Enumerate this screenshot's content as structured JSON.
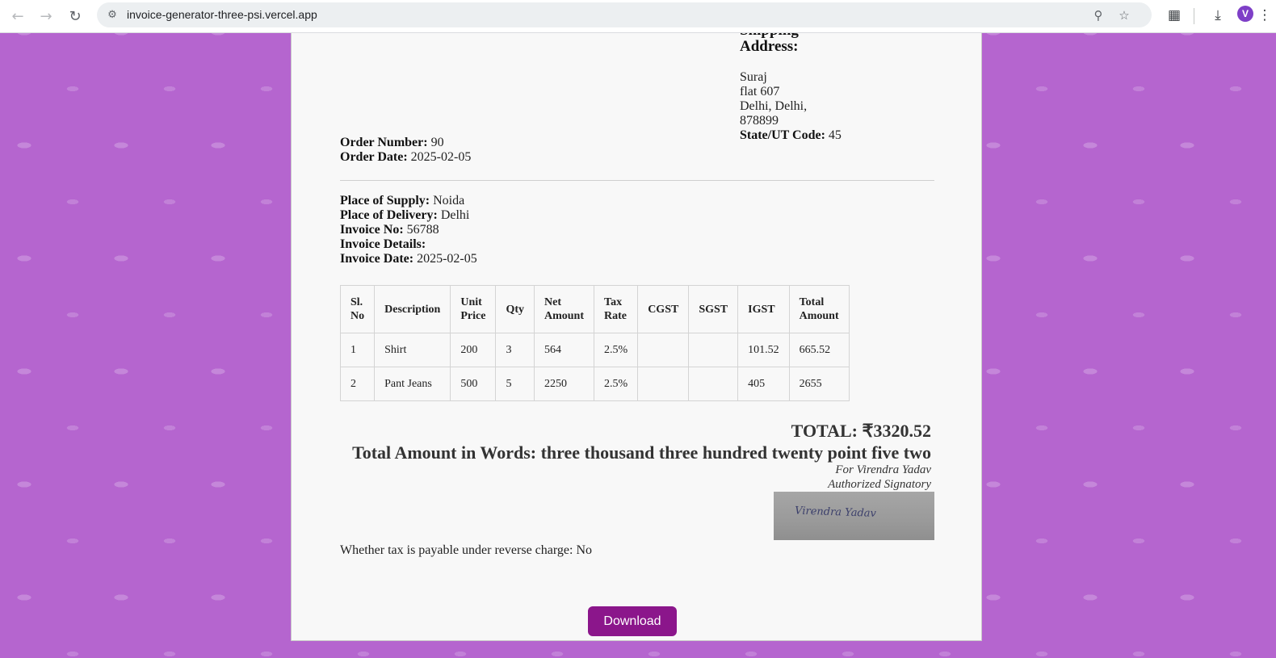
{
  "browser": {
    "url": "invoice-generator-three-psi.vercel.app",
    "avatar_letter": "V",
    "icons": [
      "back-icon",
      "forward-icon",
      "reload-icon",
      "site-settings-icon",
      "location-icon",
      "bookmark-star-icon",
      "extensions-icon",
      "download-icon",
      "more-icon"
    ]
  },
  "shipping": {
    "heading_partial": "Shipping",
    "heading": "Address:",
    "name": "Suraj",
    "line1": "flat 607",
    "line2": "Delhi, Delhi,",
    "pincode": "878899",
    "state_code_label": "State/UT Code:",
    "state_code_value": " 45"
  },
  "order": {
    "number_label": "Order Number:",
    "number_value": " 90",
    "date_label": "Order Date:",
    "date_value": " 2025-02-05"
  },
  "invoice": {
    "supply_label": "Place of Supply:",
    "supply_value": " Noida",
    "delivery_label": "Place of Delivery:",
    "delivery_value": " Delhi",
    "no_label": "Invoice No:",
    "no_value": " 56788",
    "details_label": "Invoice Details:",
    "date_label": "Invoice Date:",
    "date_value": " 2025-02-05"
  },
  "table": {
    "headers": [
      "Sl.\nNo",
      "Description",
      "Unit\nPrice",
      "Qty",
      "Net\nAmount",
      "Tax\nRate",
      "CGST",
      "SGST",
      "IGST",
      "Total\nAmount"
    ],
    "rows": [
      [
        "1",
        "Shirt",
        "200",
        "3",
        "564",
        "2.5%",
        "",
        "",
        "101.52",
        "665.52"
      ],
      [
        "2",
        "Pant Jeans",
        "500",
        "5",
        "2250",
        "2.5%",
        "",
        "",
        "405",
        "2655"
      ]
    ]
  },
  "summary": {
    "total": "TOTAL: ₹3320.52",
    "words": "Total Amount in Words: three thousand three hundred twenty point five two",
    "for_line": "For Virendra Yadav",
    "signatory": "Authorized Signatory",
    "signature": "Virendra Yadav",
    "reverse_charge": "Whether tax is payable under reverse charge: No"
  },
  "actions": {
    "download_label": "Download"
  }
}
